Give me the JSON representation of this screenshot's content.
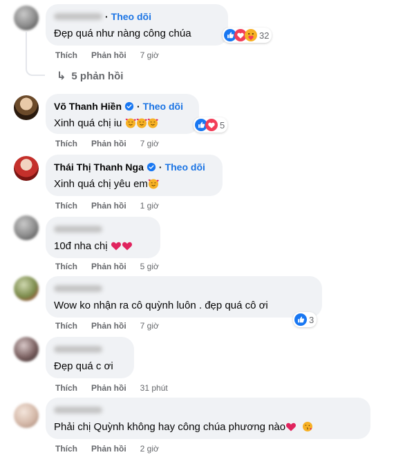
{
  "labels": {
    "like": "Thích",
    "reply": "Phản hồi",
    "follow": "Theo dõi"
  },
  "comments": [
    {
      "name": "",
      "verified": false,
      "text": "Đẹp quá như nàng công chúa",
      "time": "7 giờ",
      "reactions": [
        "like",
        "love",
        "care"
      ],
      "reaction_count": "32",
      "replies_label": "5 phản hồi"
    },
    {
      "name": "Võ Thanh Hiền",
      "verified": true,
      "text": "Xinh quá chị iu",
      "emojis": [
        "smiling-hearts",
        "smiling-hearts",
        "smiling-hearts"
      ],
      "time": "7 giờ",
      "reactions": [
        "like",
        "love"
      ],
      "reaction_count": "5"
    },
    {
      "name": "Thái Thị Thanh Nga",
      "verified": true,
      "text": "Xinh quá chị yêu em",
      "emojis": [
        "smiling-hearts"
      ],
      "time": "1 giờ"
    },
    {
      "name": "",
      "verified": false,
      "text": "10đ nha chị",
      "emojis": [
        "red-heart",
        "red-heart"
      ],
      "time": "5 giờ"
    },
    {
      "name": "",
      "verified": false,
      "text": "Wow ko nhận ra cô quỳnh luôn . đẹp quá cô ơi",
      "time": "7 giờ",
      "reactions": [
        "like"
      ],
      "reaction_count": "3"
    },
    {
      "name": "",
      "verified": false,
      "text": "Đẹp quá c ơi",
      "time": "31 phút"
    },
    {
      "name": "",
      "verified": false,
      "text": "Phải chị Quỳnh không hay công chúa phương nào",
      "emojis": [
        "red-heart",
        "face-blowing-kiss"
      ],
      "time": "2 giờ"
    }
  ],
  "colors": {
    "bubble": "#f0f2f5",
    "follow": "#1b74e4",
    "muted": "#65676b",
    "like": "#1877f2",
    "love": "#f33e58",
    "care": "#f7b125"
  }
}
